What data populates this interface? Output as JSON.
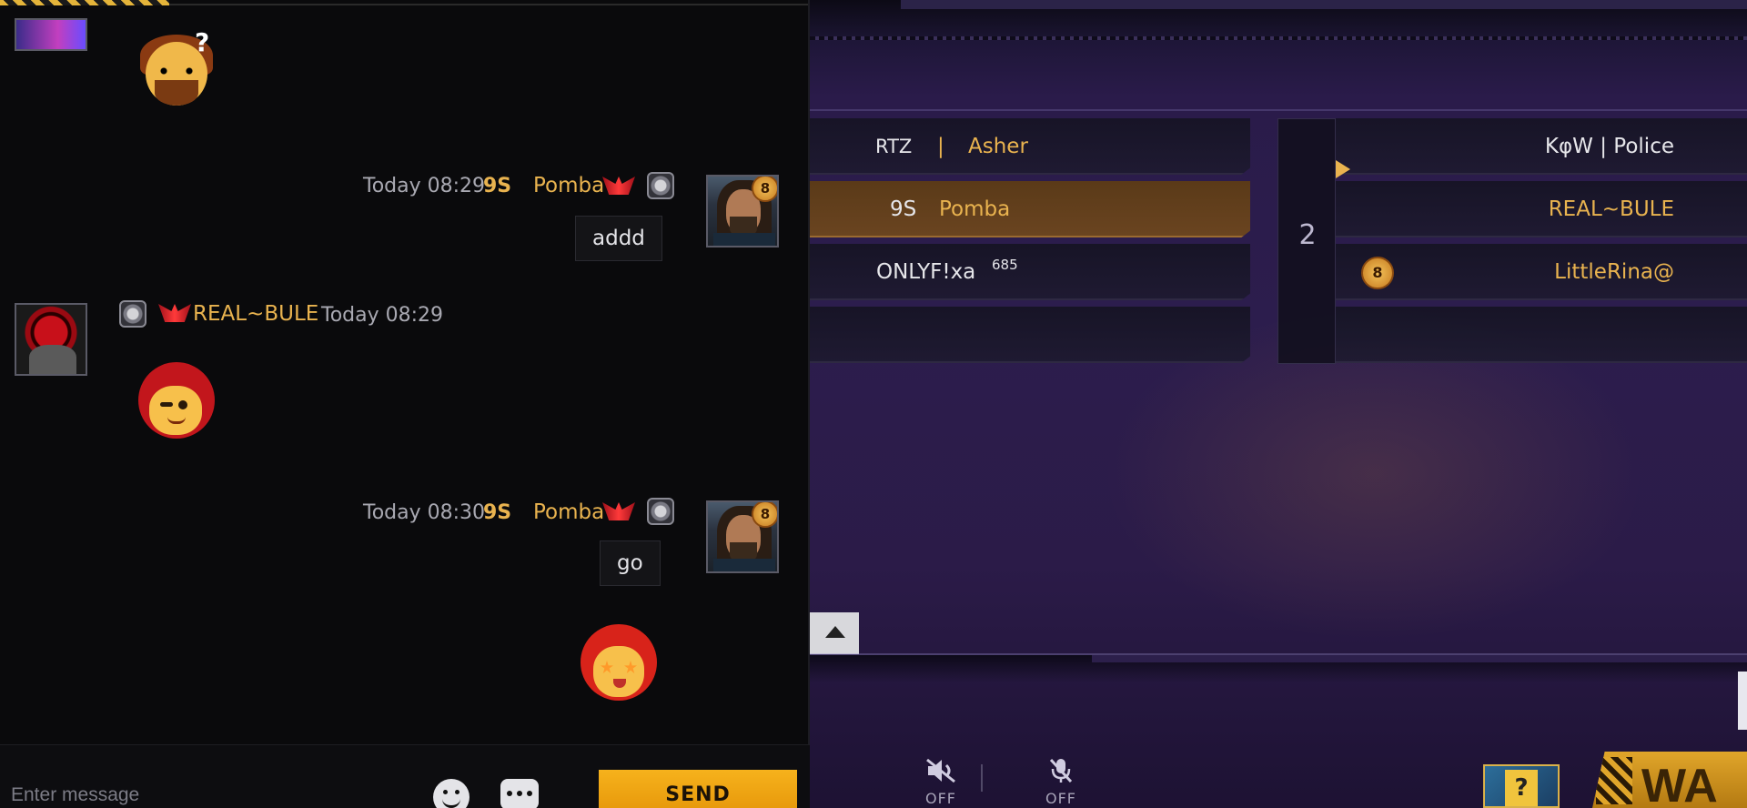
{
  "chat": {
    "messages": [
      {
        "sender": "Pomba",
        "clan_tag": "9S",
        "time": "Today 08:29",
        "text": "addd",
        "level_badge": "8",
        "outgoing": true
      },
      {
        "sender": "REAL~BULE",
        "time": "Today 08:29",
        "emote": "girl-wink-emote",
        "outgoing": false
      },
      {
        "sender": "Pomba",
        "clan_tag": "9S",
        "time": "Today 08:30",
        "text": "go",
        "level_badge": "8",
        "outgoing": true
      },
      {
        "emote": "girl-starry-eyes-emote",
        "outgoing": true
      }
    ],
    "top_emote_symbol": "?",
    "input": {
      "placeholder": "Enter message",
      "value": ""
    },
    "send_label": "SEND",
    "icons": [
      "emoji-icon",
      "more-icon"
    ]
  },
  "lobby": {
    "team_a": [
      {
        "clan": "RTZ",
        "separator": "|",
        "name": "Asher",
        "active": false
      },
      {
        "clan": "9S",
        "name": "Pomba",
        "active": true
      },
      {
        "name": "ONLYF!xa",
        "extra": "685",
        "active": false
      },
      {
        "name": "",
        "active": false
      }
    ],
    "team_b_number": "2",
    "team_b": [
      {
        "name": "KφW | Police"
      },
      {
        "name": "REAL~BULE"
      },
      {
        "name": "LittleRina@",
        "level_badge": "8"
      },
      {
        "name": ""
      }
    ],
    "controls": [
      {
        "icon": "speaker-muted-icon",
        "label": "OFF"
      },
      {
        "icon": "mic-muted-icon",
        "label": "OFF"
      }
    ],
    "war_label": "WA",
    "colors": {
      "accent_gold": "#e9b34f",
      "send_orange": "#f6b21c",
      "active_slot": "#6a4420"
    }
  }
}
